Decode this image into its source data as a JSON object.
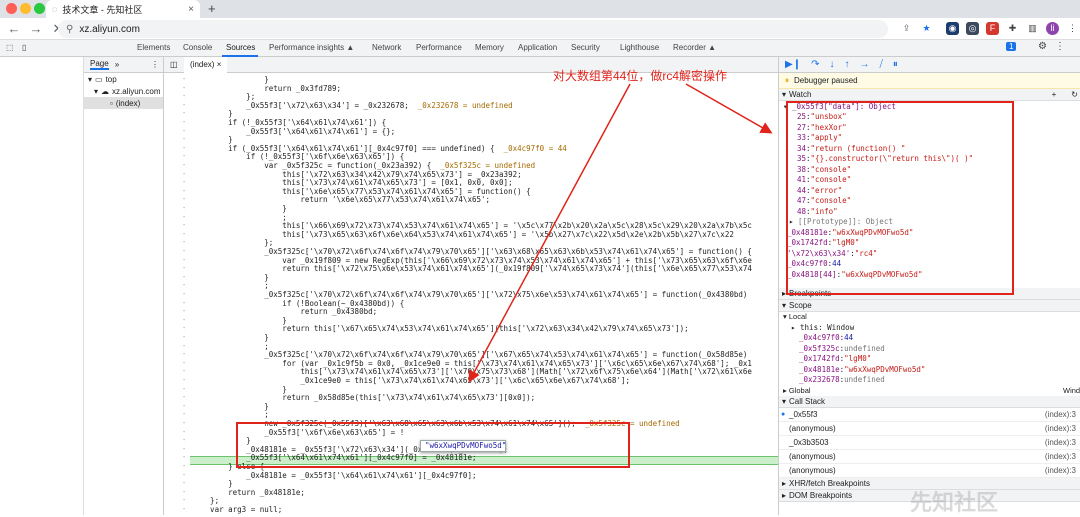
{
  "browser": {
    "tab_title": "技术文章 - 先知社区",
    "url": "xz.aliyun.com",
    "new_tab": "+",
    "profile_initial": "li"
  },
  "devtools": {
    "tabs": [
      "Elements",
      "Console",
      "Sources",
      "Performance insights ▲",
      "Network",
      "Performance",
      "Memory",
      "Application",
      "Security",
      "Lighthouse",
      "Recorder ▲"
    ],
    "active_tab": "Sources",
    "badge": "1"
  },
  "navigator": {
    "tab": "Page",
    "more": "»",
    "tree": [
      "top",
      "xz.aliyun.com",
      "(index)"
    ]
  },
  "editor": {
    "file_tab": "(index)",
    "code": [
      {
        "t": "                }"
      },
      {
        "t": "                return _0x3fd789;"
      },
      {
        "t": "            };"
      },
      {
        "t": "            _0x55f3['\\x72\\x63\\x34'] = _0x232678;  ",
        "a": "_0x232678 = undefined"
      },
      {
        "t": "        }"
      },
      {
        "t": "        if (!_0x55f3['\\x64\\x61\\x74\\x61']) {"
      },
      {
        "t": "            _0x55f3['\\x64\\x61\\x74\\x61'] = {};"
      },
      {
        "t": "        }"
      },
      {
        "t": "        if (_0x55f3['\\x64\\x61\\x74\\x61'][_0x4c97f0] === undefined) {  ",
        "a": "_0x4c97f0 = 44"
      },
      {
        "t": "            if (!_0x55f3['\\x6f\\x6e\\x63\\x65']) {"
      },
      {
        "t": "                var _0x5f325c = function(_0x23a392) {  ",
        "a": "_0x5f325c = undefined"
      },
      {
        "t": "                    this['\\x72\\x63\\x34\\x42\\x79\\x74\\x65\\x73'] = _0x23a392;"
      },
      {
        "t": "                    this['\\x73\\x74\\x61\\x74\\x65\\x73'] = [0x1, 0x0, 0x0];"
      },
      {
        "t": "                    this['\\x6e\\x65\\x77\\x53\\x74\\x61\\x74\\x65'] = function() {"
      },
      {
        "t": "                        return '\\x6e\\x65\\x77\\x53\\x74\\x61\\x74\\x65';"
      },
      {
        "t": "                    }"
      },
      {
        "t": "                    ;"
      },
      {
        "t": "                    this['\\x66\\x69\\x72\\x73\\x74\\x53\\x74\\x61\\x74\\x65'] = '\\x5c\\x77\\x2b\\x20\\x2a\\x5c\\x28\\x5c\\x29\\x20\\x2a\\x7b\\x5c"
      },
      {
        "t": "                    this['\\x73\\x65\\x63\\x6f\\x6e\\x64\\x53\\x74\\x61\\x74\\x65'] = '\\x5b\\x27\\x7c\\x22\\x5d\\x2e\\x2b\\x5b\\x27\\x7c\\x22"
      },
      {
        "t": "                };"
      },
      {
        "t": "                _0x5f325c['\\x70\\x72\\x6f\\x74\\x6f\\x74\\x79\\x70\\x65']['\\x63\\x68\\x65\\x63\\x6b\\x53\\x74\\x61\\x74\\x65'] = function() {"
      },
      {
        "t": "                    var _0x19f809 = new RegExp(this['\\x66\\x69\\x72\\x73\\x74\\x53\\x74\\x61\\x74\\x65'] + this['\\x73\\x65\\x63\\x6f\\x6e"
      },
      {
        "t": "                    return this['\\x72\\x75\\x6e\\x53\\x74\\x61\\x74\\x65'](_0x19f809['\\x74\\x65\\x73\\x74'](this['\\x6e\\x65\\x77\\x53\\x74"
      },
      {
        "t": "                }"
      },
      {
        "t": "                ;"
      },
      {
        "t": "                _0x5f325c['\\x70\\x72\\x6f\\x74\\x6f\\x74\\x79\\x70\\x65']['\\x72\\x75\\x6e\\x53\\x74\\x61\\x74\\x65'] = function(_0x4380bd)"
      },
      {
        "t": "                    if (!Boolean(~_0x4380bd)) {"
      },
      {
        "t": "                        return _0x4380bd;"
      },
      {
        "t": "                    }"
      },
      {
        "t": "                    return this['\\x67\\x65\\x74\\x53\\x74\\x61\\x74\\x65'](this['\\x72\\x63\\x34\\x42\\x79\\x74\\x65\\x73']);"
      },
      {
        "t": "                }"
      },
      {
        "t": "                ;"
      },
      {
        "t": "                _0x5f325c['\\x70\\x72\\x6f\\x74\\x6f\\x74\\x79\\x70\\x65']['\\x67\\x65\\x74\\x53\\x74\\x61\\x74\\x65'] = function(_0x58d85e)"
      },
      {
        "t": "                    for (var _0x1c9f5b = 0x0, _0x1ce9e0 = this['\\x73\\x74\\x61\\x74\\x65\\x73']['\\x6c\\x65\\x6e\\x67\\x74\\x68']; _0x1"
      },
      {
        "t": "                        this['\\x73\\x74\\x61\\x74\\x65\\x73']['\\x70\\x75\\x73\\x68'](Math['\\x72\\x6f\\x75\\x6e\\x64'](Math['\\x72\\x61\\x6e"
      },
      {
        "t": "                        _0x1ce9e0 = this['\\x73\\x74\\x61\\x74\\x65\\x73']['\\x6c\\x65\\x6e\\x67\\x74\\x68'];"
      },
      {
        "t": "                    }"
      },
      {
        "t": "                    return _0x58d85e(this['\\x73\\x74\\x61\\x74\\x65\\x73'][0x0]);"
      },
      {
        "t": "                }"
      },
      {
        "t": "                ;"
      },
      {
        "t": "                new _0x5f325c(_0x55f3)['\\x63\\x68\\x65\\x63\\x6b\\x53\\x74\\x61\\x74\\x65']();  ",
        "a": "_0x5f325c = undefined"
      },
      {
        "t": "                _0x55f3['\\x6f\\x6e\\x63\\x65'] = !"
      },
      {
        "t": "            }"
      },
      {
        "t": "            _0x48181e = _0x55f3['\\x72\\x63\\x34'](_0x48181e, _0x1742fd);"
      },
      {
        "t": "            _0x55f3['\\x64\\x61\\x74\\x61'][_0x4c97f0] = _0x48181e;"
      },
      {
        "t": "        } else {"
      },
      {
        "t": "            _0x48181e = _0x55f3['\\x64\\x61\\x74\\x61'][_0x4c97f0];"
      },
      {
        "t": "        }"
      },
      {
        "t": "        return _0x48181e;"
      },
      {
        "t": "    };"
      },
      {
        "t": "    var arg3 = null;"
      },
      {
        "t": "    var arg4 = null;"
      }
    ],
    "tooltip": "\"w6xXwqPDvMOFwo5d\""
  },
  "annotation": "对大数组第44位，做rc4解密操作",
  "debugger": {
    "paused_text": "Debugger paused",
    "watch_title": "Watch",
    "watch_root": "_0x55f3[\"data\"]: Object",
    "watch_items": [
      {
        "k": "25",
        "v": "\"unsbox\""
      },
      {
        "k": "27",
        "v": "\"hexXor\""
      },
      {
        "k": "33",
        "v": "\"apply\""
      },
      {
        "k": "34",
        "v": "\"return (function() \""
      },
      {
        "k": "35",
        "v": "\"{}.constructor(\\\"return this\\\")( )\""
      },
      {
        "k": "38",
        "v": "\"console\""
      },
      {
        "k": "41",
        "v": "\"console\""
      },
      {
        "k": "44",
        "v": "\"error\""
      },
      {
        "k": "47",
        "v": "\"console\""
      },
      {
        "k": "48",
        "v": "\"info\""
      }
    ],
    "prototype": "[[Prototype]]: Object",
    "watch_exprs": [
      {
        "k": "_0x48181e",
        "v": "\"w6xXwqPDvMOFwo5d\""
      },
      {
        "k": "_0x1742fd",
        "v": "\"lgM0\""
      },
      {
        "k": "'\\x72\\x63\\x34'",
        "v": "\"rc4\""
      },
      {
        "k": "_0x4c97f0",
        "v": "44"
      },
      {
        "k": "_0x4818[44]",
        "v": "\"w6xXwqPDvMOFwo5d\""
      }
    ],
    "breakpoints": "Breakpoints",
    "scope": "Scope",
    "local": "Local",
    "this_window": "this: Window",
    "local_items": [
      {
        "k": "_0x4c97f0",
        "v": "44"
      },
      {
        "k": "_0x5f325c",
        "v": "undefined"
      },
      {
        "k": "_0x1742fd",
        "v": "\"lgM0\""
      },
      {
        "k": "_0x48181e",
        "v": "\"w6xXwqPDvMOFwo5d\""
      },
      {
        "k": "_0x232678",
        "v": "undefined"
      }
    ],
    "global": "Global",
    "global_val": "Window",
    "call_stack": "Call Stack",
    "frames": [
      {
        "n": "_0x55f3",
        "l": "(index):3"
      },
      {
        "n": "(anonymous)",
        "l": "(index):3"
      },
      {
        "n": "_0x3b3503",
        "l": "(index):3"
      },
      {
        "n": "(anonymous)",
        "l": "(index):3"
      },
      {
        "n": "(anonymous)",
        "l": "(index):3"
      }
    ],
    "xhr": "XHR/fetch Breakpoints",
    "dom": "DOM Breakpoints"
  },
  "watermark": "先知社区",
  "colors": {
    "red": "#e0241b",
    "blue": "#1a73e8"
  }
}
